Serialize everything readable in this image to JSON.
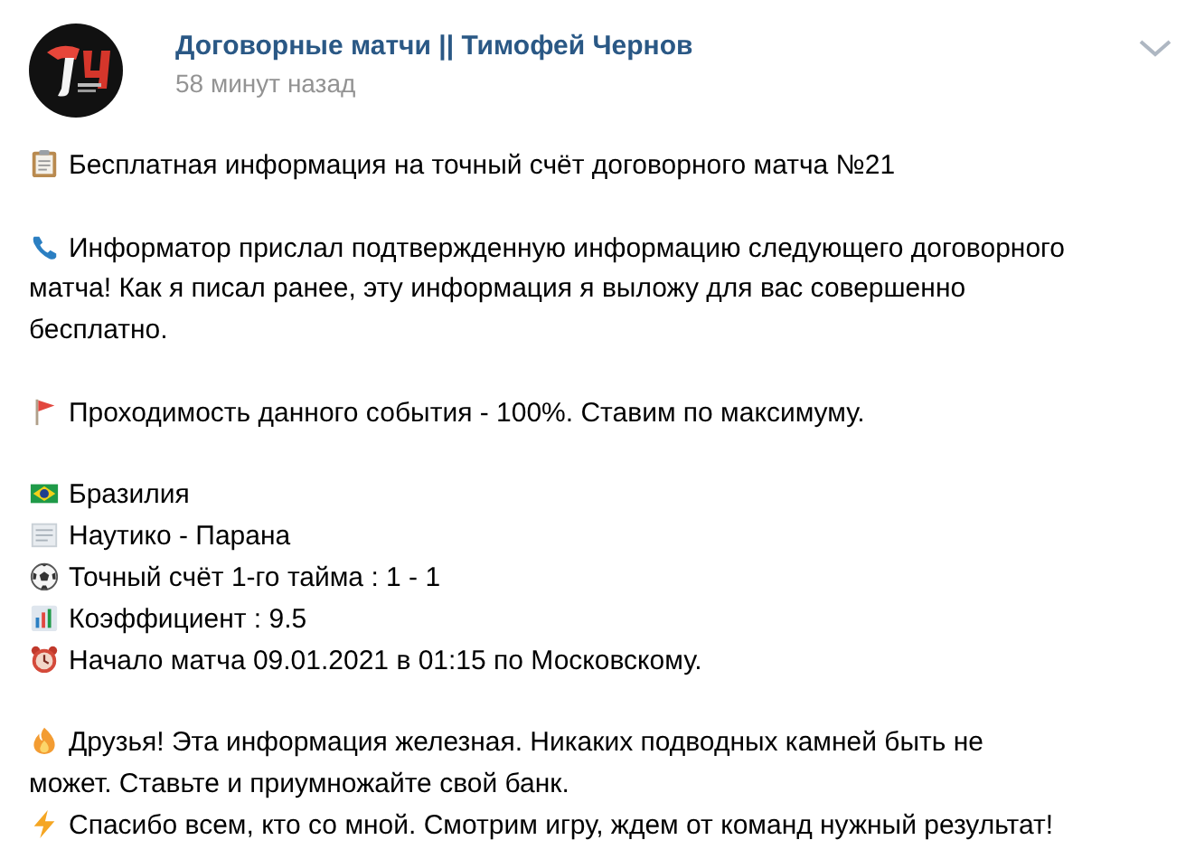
{
  "post": {
    "author": "Договорные матчи || Тимофей Чернов",
    "time": "58 минут назад",
    "blocks": [
      {
        "lines": [
          {
            "kind": "clipboard",
            "text": "Бесплатная информация на точный счёт договорного матча №21"
          }
        ]
      },
      {
        "lines": [
          {
            "kind": "phone",
            "text": "Информатор прислал подтвержденную информацию следующего договорного"
          },
          {
            "kind": "plain",
            "text": "матча! Как я писал ранее, эту информация я выложу для вас совершенно"
          },
          {
            "kind": "plain",
            "text": "бесплатно."
          }
        ]
      },
      {
        "lines": [
          {
            "kind": "flag",
            "text": "Проходимость данного события - 100%. Ставим по максимуму."
          }
        ]
      },
      {
        "lines": [
          {
            "kind": "brazil",
            "text": "Бразилия"
          },
          {
            "kind": "document",
            "text": "Наутико - Парана"
          },
          {
            "kind": "ball",
            "text": "Точный счёт 1-го тайма : 1 - 1"
          },
          {
            "kind": "chart",
            "text": "Коэффициент : 9.5"
          },
          {
            "kind": "alarm",
            "text": "Начало матча 09.01.2021 в 01:15 по Московскому."
          }
        ]
      },
      {
        "lines": [
          {
            "kind": "fire",
            "text": "Друзья! Эта информация железная. Никаких подводных камней быть не"
          },
          {
            "kind": "plain",
            "text": "может. Ставьте и приумножайте свой банк."
          },
          {
            "kind": "lightning",
            "text": "Спасибо всем, кто со мной. Смотрим игру, ждем от команд нужный результат!"
          }
        ]
      }
    ]
  }
}
